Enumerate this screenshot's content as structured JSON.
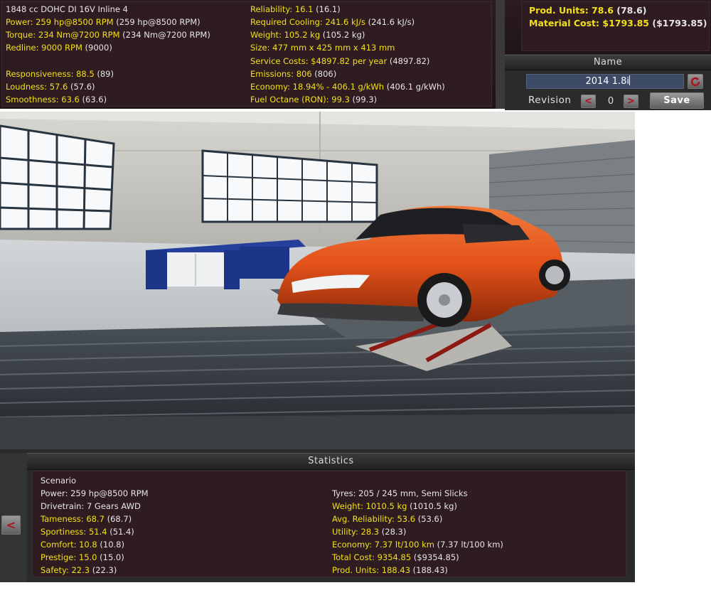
{
  "engine": {
    "left_col": [
      {
        "label": "1848 cc DOHC DI 16V Inline 4",
        "value": ""
      },
      {
        "label": "Power: 259 hp@8500 RPM",
        "value": " (259 hp@8500 RPM)"
      },
      {
        "label": "Torque: 234 Nm@7200 RPM",
        "value": " (234 Nm@7200 RPM)"
      },
      {
        "label": "Redline: 9000 RPM",
        "value": " (9000)"
      },
      {
        "label": "Responsiveness: 88.5",
        "value": " (89)"
      },
      {
        "label": "Loudness: 57.6",
        "value": " (57.6)"
      },
      {
        "label": "Smoothness: 63.6",
        "value": " (63.6)"
      }
    ],
    "right_col": [
      {
        "label": "Reliability: 16.1",
        "value": " (16.1)"
      },
      {
        "label": "Required Cooling: 241.6 kJ/s",
        "value": " (241.6 kJ/s)"
      },
      {
        "label": "Weight: 105.2 kg",
        "value": " (105.2 kg)"
      },
      {
        "label": "Size: 477 mm x 425 mm x 413 mm",
        "value": ""
      },
      {
        "label": "Service Costs: $4897.82 per year",
        "value": " (4897.82)"
      },
      {
        "label": "Emissions: 806",
        "value": " (806)"
      },
      {
        "label": "Economy: 18.94% - 406.1 g/kWh",
        "value": " (406.1 g/kWh)"
      },
      {
        "label": "Fuel Octane (RON): 99.3",
        "value": " (99.3)"
      }
    ]
  },
  "production": {
    "units_label": "Prod. Units: 78.6",
    "units_value": " (78.6)",
    "cost_label": "Material Cost: $1793.85",
    "cost_value": " ($1793.85)"
  },
  "name_panel": {
    "header": "Name",
    "name_value": "2014 1.8i",
    "revision_label": "Revision",
    "prev_label": "<",
    "revision_value": "0",
    "next_label": ">",
    "save_label": "Save"
  },
  "statistics": {
    "header": "Statistics",
    "back_label": "<",
    "left_col": [
      {
        "label": "Scenario",
        "value": "",
        "color": "white"
      },
      {
        "label": "Power: 259 hp@8500 RPM",
        "value": "",
        "color": "white"
      },
      {
        "label": "Drivetrain: 7 Gears AWD",
        "value": "",
        "color": "white"
      },
      {
        "label": "Tameness: 68.7",
        "value": " (68.7)",
        "color": "yellow"
      },
      {
        "label": "Sportiness: 51.4",
        "value": " (51.4)",
        "color": "yellow"
      },
      {
        "label": "Comfort: 10.8",
        "value": " (10.8)",
        "color": "yellow"
      },
      {
        "label": "Prestige: 15.0",
        "value": " (15.0)",
        "color": "yellow"
      },
      {
        "label": "Safety: 22.3",
        "value": " (22.3)",
        "color": "yellow"
      }
    ],
    "right_col": [
      {
        "label": "Tyres: 205 / 245 mm, Semi Slicks",
        "value": "",
        "color": "white"
      },
      {
        "label": "Weight: 1010.5 kg",
        "value": " (1010.5 kg)",
        "color": "yellow"
      },
      {
        "label": "Avg. Reliability: 53.6",
        "value": " (53.6)",
        "color": "yellow"
      },
      {
        "label": "Utility: 28.3",
        "value": " (28.3)",
        "color": "yellow"
      },
      {
        "label": "Economy: 7.37 lt/100 km",
        "value": " (7.37 lt/100 km)",
        "color": "yellow"
      },
      {
        "label": "Total Cost: 9354.85",
        "value": " ($9354.85)",
        "color": "yellow"
      },
      {
        "label": "Prod. Units: 188.43",
        "value": " (188.43)",
        "color": "yellow"
      }
    ]
  },
  "colors": {
    "accent_text": "#f2e01a",
    "panel_bg": "#2e1c20",
    "car_body": "#e8541c"
  }
}
